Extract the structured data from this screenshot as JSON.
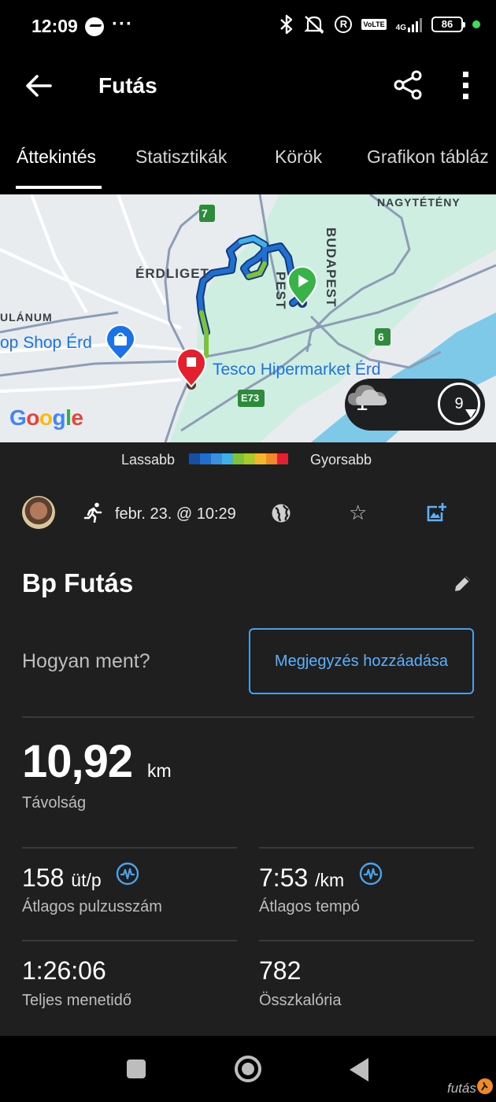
{
  "status_bar": {
    "time": "12:09",
    "dots": "···",
    "battery": "86",
    "network": "4G",
    "volte": "VoLTE",
    "r_badge": "R",
    "icons": [
      "messenger-icon",
      "bluetooth-icon",
      "mute-icon",
      "r-icon",
      "volte-icon",
      "signal-icon",
      "battery-icon"
    ]
  },
  "app_bar": {
    "title": "Futás",
    "icons": [
      "back-arrow-icon",
      "share-icon",
      "more-vert-icon"
    ]
  },
  "tabs": [
    {
      "label": "Áttekintés",
      "active": true
    },
    {
      "label": "Statisztikák",
      "active": false
    },
    {
      "label": "Körök",
      "active": false
    },
    {
      "label": "Grafikon tábláz",
      "active": false
    }
  ],
  "map": {
    "labels": {
      "nagyteteny": "NAGYTÉTÉNY",
      "erdliget": "ÉRDLIGET",
      "budapest": "BUDAPEST",
      "pest": "PEST",
      "ulanum": "ULÁNUM",
      "shop": "op Shop Érd",
      "tesco": "Tesco Hipermarket Érd",
      "road_7": "7",
      "road_6": "6",
      "road_e73": "E73"
    },
    "google_logo": "Google",
    "weather": {
      "temp": "1°",
      "wind": "9",
      "condition_icon": "cloud-icon"
    },
    "colors": {
      "route_blue": "#1f6fd1",
      "route_green": "#7cc23a",
      "water": "#7ec8e8",
      "park": "#cdeee0",
      "start": "#37b34a",
      "end": "#e5202e"
    }
  },
  "legend": {
    "slow": "Lassabb",
    "fast": "Gyorsabb",
    "colors": [
      "#1a4fa0",
      "#1e6fd1",
      "#3a8fe0",
      "#3fb1e8",
      "#7cc23a",
      "#a8cc2a",
      "#f2b82a",
      "#f08a24",
      "#e5202e"
    ]
  },
  "activity": {
    "date": "febr. 23. @ 10:29",
    "name": "Bp Futás",
    "how_label": "Hogyan ment?",
    "note_button": "Megjegyzés hozzáadása",
    "icons": [
      "avatar",
      "running-icon",
      "globe-icon",
      "star-icon",
      "add-photo-icon",
      "edit-pencil-icon"
    ]
  },
  "stats": {
    "distance": {
      "value": "10,92",
      "unit": "km",
      "label": "Távolság"
    },
    "heart_rate": {
      "value": "158",
      "unit": "üt/p",
      "label": "Átlagos pulzusszám"
    },
    "pace": {
      "value": "7:53",
      "unit": "/km",
      "label": "Átlagos tempó"
    },
    "time": {
      "value": "1:26:06",
      "label": "Teljes menetidő"
    },
    "calories": {
      "value": "782",
      "label": "Összkalória"
    }
  },
  "nav_bar": {
    "icons": [
      "recents-square-icon",
      "home-circle-icon",
      "back-triangle-icon"
    ],
    "watermark": "futás"
  }
}
